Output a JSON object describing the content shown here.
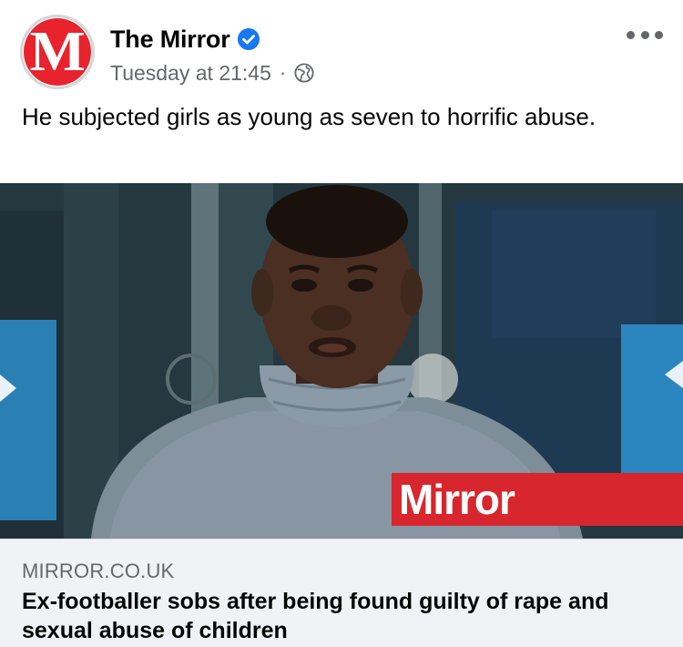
{
  "post": {
    "page_name": "The Mirror",
    "timestamp": "Tuesday at 21:45",
    "separator": "·",
    "privacy_icon": "globe-icon",
    "verified_icon": "verified-badge-icon",
    "more_icon": "more-options-icon",
    "avatar_letter": "M",
    "text": "He subjected girls as young as seven to horrific abuse."
  },
  "link_preview": {
    "image_badge": "Mirror",
    "domain": "MIRROR.CO.UK",
    "title": "Ex-footballer sobs after being found guilty of rape and sexual abuse of children"
  },
  "colors": {
    "brand_red": "#e8232e",
    "verified_blue": "#1877f2",
    "meta_gray": "#65676b",
    "footer_bg": "#f0f2f5"
  }
}
